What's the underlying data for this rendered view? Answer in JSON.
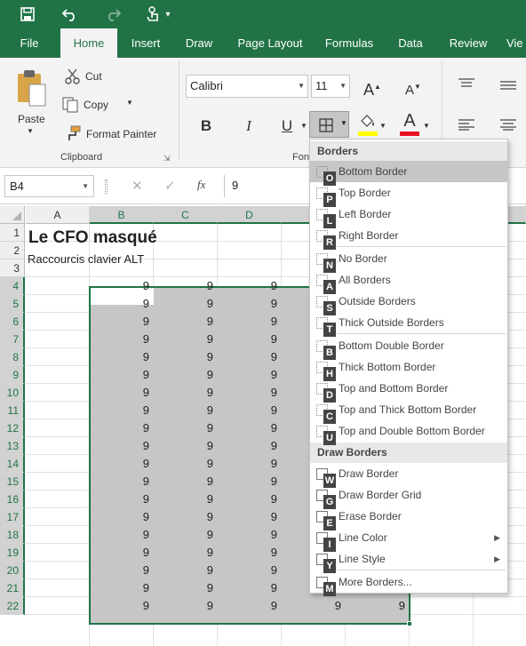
{
  "qat": {
    "save": "save-icon",
    "undo": "undo-icon",
    "redo": "redo-icon",
    "touch": "touch-mode-icon",
    "more": "▾"
  },
  "tabs": [
    "File",
    "Home",
    "Insert",
    "Draw",
    "Page Layout",
    "Formulas",
    "Data",
    "Review",
    "Vie"
  ],
  "ribbon": {
    "paste_label": "Paste",
    "cut_label": "Cut",
    "copy_label": "Copy",
    "format_painter_label": "Format Painter",
    "clipboard_group": "Clipboard",
    "font_group": "Fon",
    "font_name": "Calibri",
    "font_size": "11",
    "bold": "B",
    "italic": "I",
    "underline": "U",
    "grow_font": "A",
    "shrink_font": "A",
    "font_color_letter": "A",
    "font_color": "#e81123",
    "fill_color": "#ffff00"
  },
  "formula_bar": {
    "name_box": "B4",
    "cancel": "✕",
    "enter": "✓",
    "fx": "fx",
    "formula": "9"
  },
  "columns": [
    "A",
    "B",
    "C",
    "D"
  ],
  "rows": [
    "1",
    "2",
    "3",
    "4",
    "5",
    "6",
    "7",
    "8",
    "9",
    "10",
    "11",
    "12",
    "13",
    "14",
    "15",
    "16",
    "17",
    "18",
    "19",
    "20",
    "21",
    "22"
  ],
  "cells": {
    "A1": "Le CFO masqué",
    "A2": "Raccourcis clavier ALT",
    "value": "9"
  },
  "menu": {
    "borders_header": "Borders",
    "draw_header": "Draw Borders",
    "items": [
      {
        "label": "Bottom Border",
        "key": "O"
      },
      {
        "label": "Top Border",
        "key": "P"
      },
      {
        "label": "Left Border",
        "key": "L"
      },
      {
        "label": "Right Border",
        "key": "R"
      },
      {
        "label": "No Border",
        "key": "N"
      },
      {
        "label": "All Borders",
        "key": "A"
      },
      {
        "label": "Outside Borders",
        "key": "S"
      },
      {
        "label": "Thick Outside Borders",
        "key": "T"
      },
      {
        "label": "Bottom Double Border",
        "key": "B"
      },
      {
        "label": "Thick Bottom Border",
        "key": "H"
      },
      {
        "label": "Top and Bottom Border",
        "key": "D"
      },
      {
        "label": "Top and Thick Bottom Border",
        "key": "C"
      },
      {
        "label": "Top and Double Bottom Border",
        "key": "U"
      }
    ],
    "draw_items": [
      {
        "label": "Draw Border",
        "key": "W"
      },
      {
        "label": "Draw Border Grid",
        "key": "G"
      },
      {
        "label": "Erase Border",
        "key": "E"
      },
      {
        "label": "Line Color",
        "key": "I"
      },
      {
        "label": "Line Style",
        "key": "Y"
      },
      {
        "label": "More Borders...",
        "key": "M"
      }
    ]
  }
}
